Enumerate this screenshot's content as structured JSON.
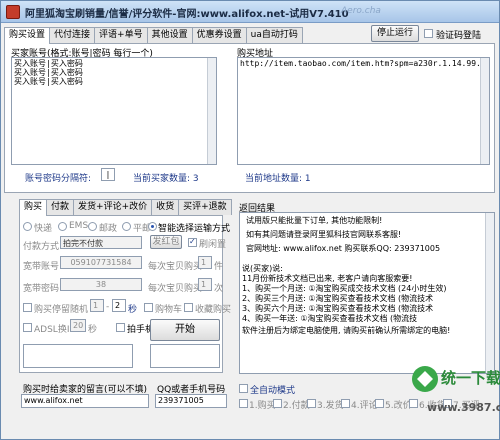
{
  "window": {
    "title": "阿里狐淘宝刷销量/信誉/评分软件-官网:www.alifox.net-试用V7.410",
    "watermark": "Aero.cha"
  },
  "top_tabs": [
    "购买设置",
    "代付连接",
    "评语+单号",
    "其他设置",
    "优惠券设置",
    "ua自动打码"
  ],
  "top_tab_active": 0,
  "buttons": {
    "stop": "停止运行",
    "start": "开始",
    "addr_pkg": "发红包"
  },
  "verify_login": "验证码登陆",
  "left": {
    "header": "买家账号(格式:账号|密码 每行一个)",
    "accounts": [
      "买入账号|买入密码",
      "买入账号|买入密码",
      "买入账号|买入密码"
    ],
    "sep_label": "账号密码分隔符:",
    "sep_value": "|",
    "count_label": "当前买家数量: 3"
  },
  "right": {
    "header": "购买地址",
    "url": "http://item.taobao.com/item.htm?spm=a230r.1.14.99.pgJ",
    "count_label": "当前地址数量: 1"
  },
  "bottom_tabs": [
    "购买",
    "付款",
    "发货+评论+改价",
    "收货",
    "买评+退款"
  ],
  "bottom_tab_active": 0,
  "shipping": {
    "options": [
      "快递",
      "EMS",
      "邮政",
      "平邮",
      "智能选择运输方式"
    ],
    "selected": 4
  },
  "form": {
    "pay_label": "付款方式",
    "pay_value": "拍完不付款",
    "auto_rebuy": "刷闲置",
    "bao_label": "宽带账号",
    "bao_value": "05910773158​4",
    "per_label": "每次宝贝购买",
    "per_value": "1",
    "per_unit": "件",
    "pwd_label": "宽带密码",
    "pwd_value": "38",
    "each_label": "每次宝贝购买",
    "each_value": "1",
    "each_unit": "次",
    "stay_label": "购买停留随机",
    "stay_from": "1",
    "stay_to": "2",
    "stay_unit": "秒",
    "cart_label": "购物车",
    "fav_label": "收藏购买",
    "adsl_label": "ADSL换IP",
    "adsl_value": "20",
    "adsl_unit": "秒",
    "mobile_label": "拍手机订单"
  },
  "result": {
    "header": "返回结果",
    "lines": [
      "试用版只能批量下订单, 其他功能限制!",
      "如有其问题请登录阿里狐科技官网联系客服!",
      "官网地址: www.alifox.net 购买联系QQ: 239371005",
      "说(买家)说:",
      "11月份新技术文档已出来, 老客户请向客服索要!",
      "1、购买一个月送: ①淘宝购买成交技术文档 (24小时生效)",
      "2、购买三个月送: ①淘宝购买查看技术文档 (物流技术",
      "3、购买六个月送: ①淘宝购买查看技术文档 (物流技术",
      "4、购买一年送: ①淘宝购买查看技术文档 (物流技",
      "软件注册后为绑定电脑使用, 请购买前确认所需绑定的电脑!"
    ]
  },
  "message": {
    "label": "购买时给卖家的留言(可以不填)",
    "value": "www.alifox.net"
  },
  "qq": {
    "label": "QQ或者手机号码",
    "value": "239371005"
  },
  "full_auto": "全自动模式",
  "mode_checks": [
    "1.购买",
    "2.付款",
    "3.发货",
    "4.评论",
    "5.改价",
    "6.收货",
    "7.买评"
  ],
  "logo": {
    "brand": "统一下载站",
    "site": "www.3987.com"
  }
}
